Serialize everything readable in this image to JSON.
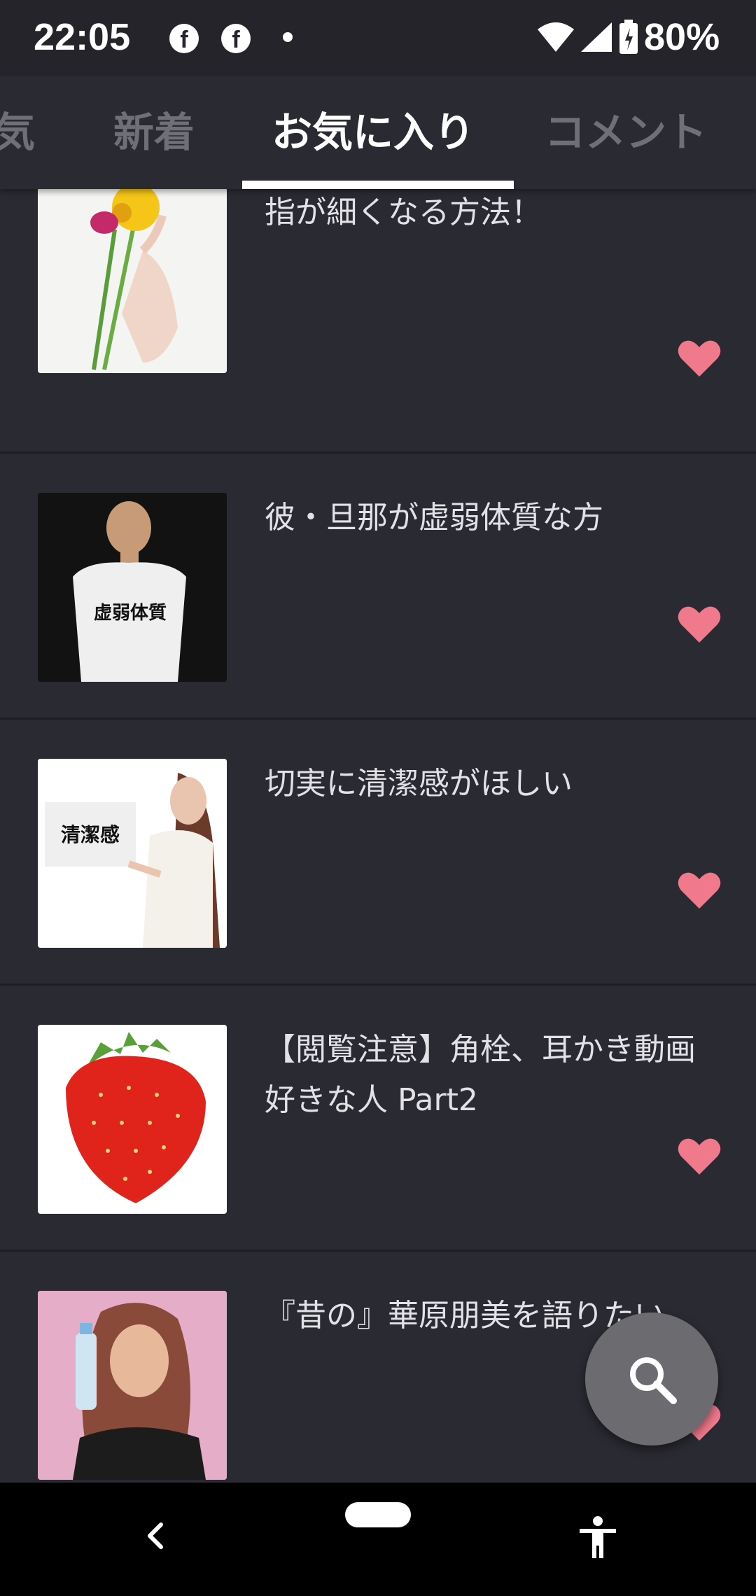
{
  "status_bar": {
    "time": "22:05",
    "notification_icons": [
      "facebook-icon",
      "facebook-icon",
      "dot-icon"
    ],
    "battery": "80%"
  },
  "tabs": [
    {
      "label": "気",
      "active": false
    },
    {
      "label": "新着",
      "active": false
    },
    {
      "label": "お気に入り",
      "active": true
    },
    {
      "label": "コメント",
      "active": false
    }
  ],
  "items": [
    {
      "title": "指が細くなる方法！",
      "favorite": true
    },
    {
      "title": "彼・旦那が虚弱体質な方",
      "favorite": true
    },
    {
      "title": "切実に清潔感がほしい",
      "favorite": true
    },
    {
      "title": "【閲覧注意】角栓、耳かき動画好きな人 Part2",
      "favorite": true
    },
    {
      "title": "『昔の』華原朋美を語りたい",
      "favorite": true
    }
  ],
  "thumb_text": {
    "tshirt": "虚弱体質",
    "sign": "清潔感"
  },
  "colors": {
    "background": "#2a2a32",
    "heart": "#f07a8c",
    "fab": "#6b6b70"
  }
}
